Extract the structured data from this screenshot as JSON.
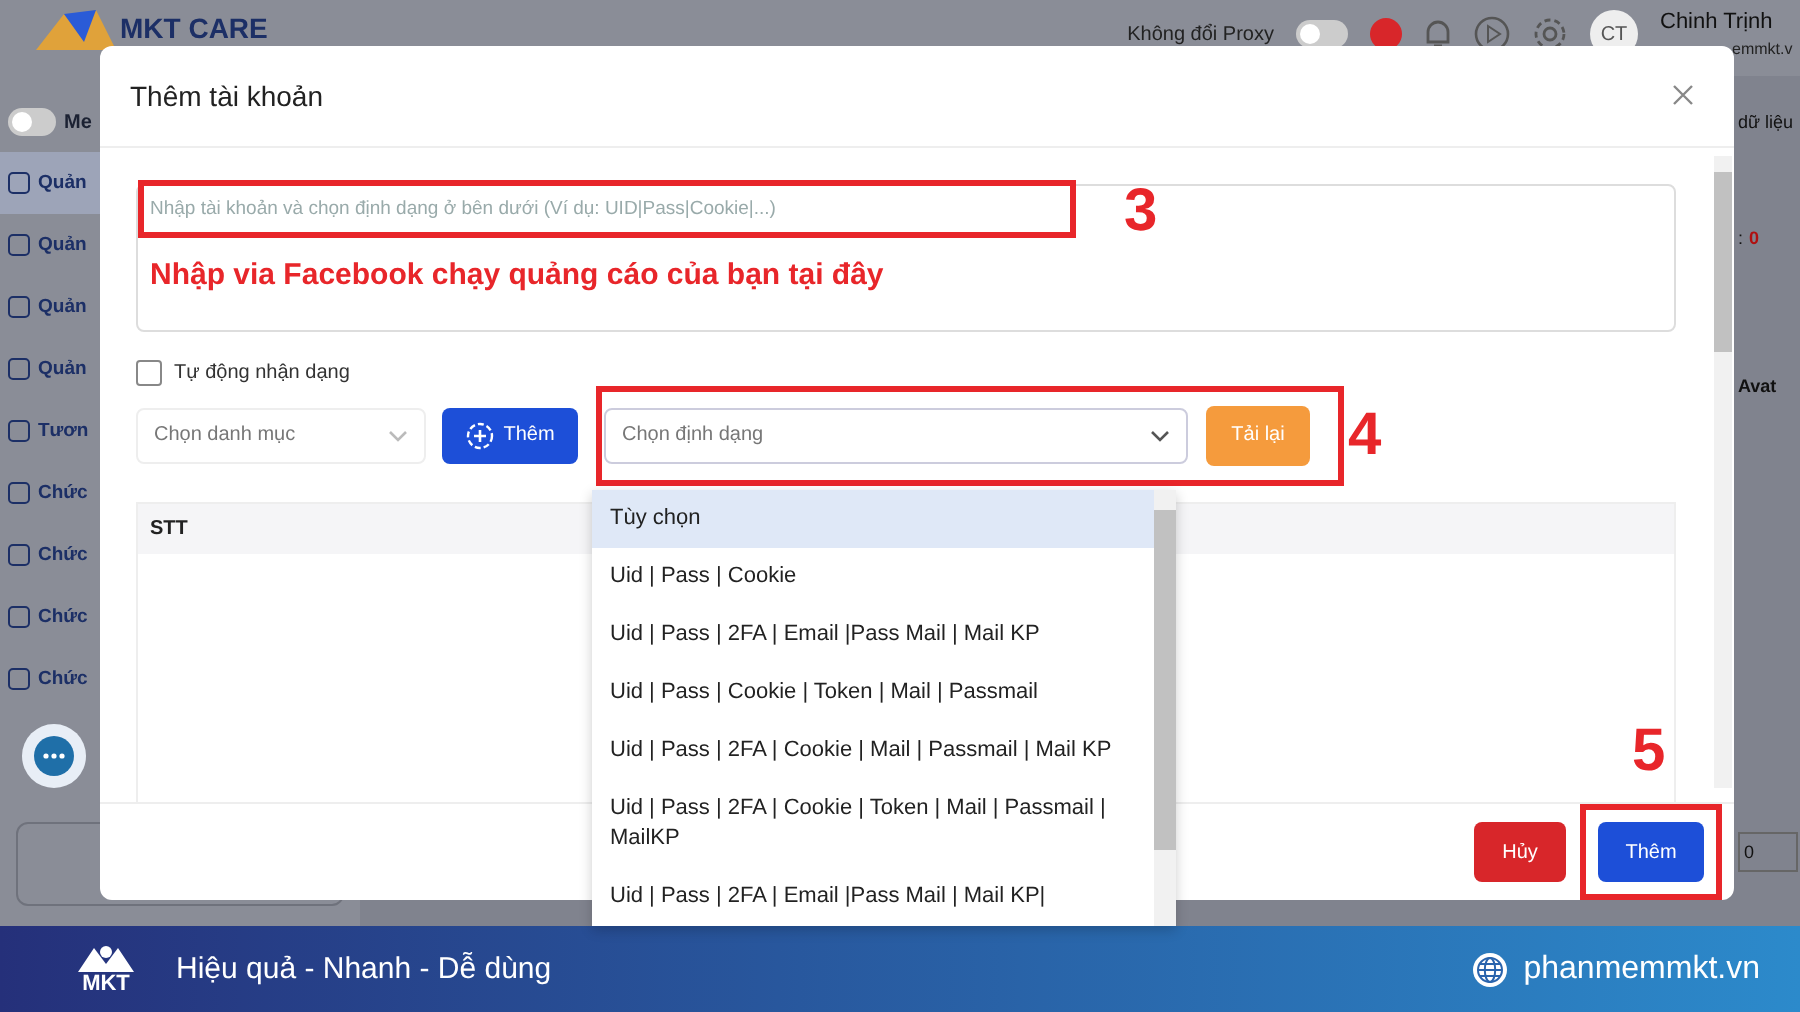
{
  "background_app": {
    "logo_text": "MKT CARE",
    "proxy_label": "Không đổi Proxy",
    "proxy_on": false,
    "avatar_initials": "CT",
    "user_name": "Chinh Trịnh",
    "user_email": "emmkt.v",
    "sidebar": {
      "toggle_label": "Me",
      "menu_expanded": false,
      "items": [
        {
          "label": "Quản",
          "selected": true
        },
        {
          "label": "Quản",
          "selected": false
        },
        {
          "label": "Quản",
          "selected": false
        },
        {
          "label": "Quản",
          "selected": false
        },
        {
          "label": "Tươn",
          "selected": false
        },
        {
          "label": "Chức",
          "selected": false
        },
        {
          "label": "Chức",
          "selected": false
        },
        {
          "label": "Chức",
          "selected": false
        },
        {
          "label": "Chức",
          "selected": false
        }
      ]
    },
    "side_panel": {
      "header": "dữ liệu",
      "count_label": ":",
      "count": "0",
      "column": "Avat",
      "page_value": "0"
    }
  },
  "modal": {
    "title": "Thêm tài khoản",
    "input": {
      "placeholder": "Nhập tài khoản và chọn định dạng ở bên dưới (Ví dụ: UID|Pass|Cookie|...)"
    },
    "note": "Nhập via Facebook chạy quảng cáo của bạn tại đây",
    "auto_detect": {
      "label": "Tự động nhận dạng",
      "checked": false
    },
    "category_select": {
      "placeholder": "Chọn danh mục"
    },
    "add_button": "Thêm",
    "format_select": {
      "placeholder": "Chọn định dạng",
      "expanded": true
    },
    "reload_button": "Tải lại",
    "table": {
      "columns": [
        "STT"
      ]
    },
    "format_options": [
      {
        "label": "Tùy chọn",
        "selected": true
      },
      {
        "label": "Uid | Pass | Cookie",
        "selected": false
      },
      {
        "label": "Uid | Pass | 2FA | Email |Pass Mail | Mail KP",
        "selected": false
      },
      {
        "label": "Uid | Pass | Cookie | Token | Mail | Passmail",
        "selected": false
      },
      {
        "label": "Uid | Pass | 2FA | Cookie | Mail | Passmail | Mail KP",
        "selected": false
      },
      {
        "label": "Uid | Pass | 2FA | Cookie | Token | Mail | Passmail | MailKP",
        "selected": false
      },
      {
        "label": "Uid | Pass | 2FA | Email |Pass Mail | Mail KP|",
        "selected": false
      }
    ],
    "cancel_button": "Hủy",
    "submit_button": "Thêm"
  },
  "annotations": [
    {
      "label": "3"
    },
    {
      "label": "4"
    },
    {
      "label": "5"
    }
  ],
  "banner": {
    "logo_text": "MKT",
    "slogan": "Hiệu quả - Nhanh - Dễ dùng",
    "website": "phanmemmkt.vn"
  }
}
